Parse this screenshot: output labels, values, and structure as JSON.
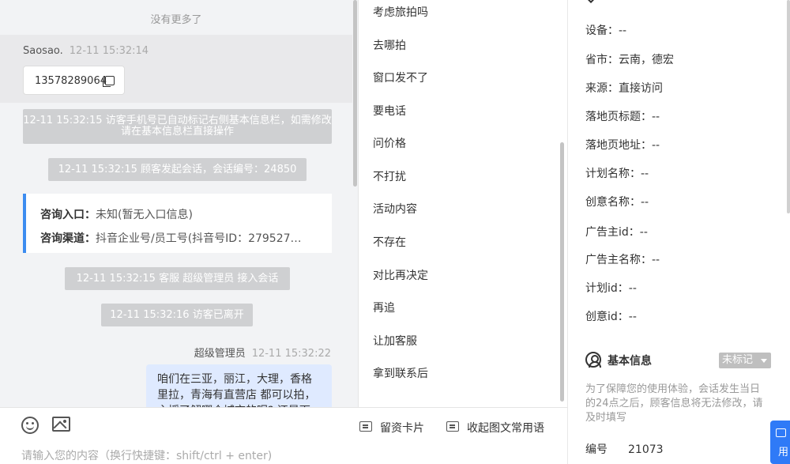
{
  "chat": {
    "no_more": "没有更多了",
    "visitor_name": "Saosao.",
    "visitor_time": "12-11 15:32:14",
    "visitor_phone": "13578289064",
    "sys_msgs": [
      "12-11 15:32:15 访客手机号已自动标记右侧基本信息栏，如需修改请在基本信息栏直接操作",
      "12-11 15:32:15 顾客发起会话，会话编号：24850",
      "12-11 15:32:15 客服 超级管理员 接入会话",
      "12-11 15:32:16 访客已离开"
    ],
    "entry_label": "咨询入口：",
    "entry_value": "未知(暂无入口信息)",
    "channel_label": "咨询渠道：",
    "channel_value": "抖音企业号/员工号(抖音号ID：279527…",
    "agent_name": "超级管理员",
    "agent_time": "12-11 15:32:22",
    "agent_message": "咱们在三亚，丽江，大理，香格里拉，青海有直营店 都可以拍，主授了解哪个城市的呢? 还是下"
  },
  "input": {
    "leave_card": "留资卡片",
    "collapse_phrases": "收起图文常用语",
    "placeholder": "请输入您的内容（换行快捷键：shift/ctrl + enter)"
  },
  "quick_replies": [
    "考虑旅拍吗",
    "去哪拍",
    "窗口发不了",
    "要电话",
    "问价格",
    "不打扰",
    "活动内容",
    "不存在",
    "对比再决定",
    "再追",
    "让加客服",
    "拿到联系后"
  ],
  "info": {
    "fields": [
      {
        "label": "设备：",
        "value": "--"
      },
      {
        "label": "省市：",
        "value": "云南，德宏"
      },
      {
        "label": "来源：",
        "value": "直接访问"
      },
      {
        "label": "落地页标题：",
        "value": "--"
      },
      {
        "label": "落地页地址：",
        "value": "--"
      },
      {
        "label": "计划名称：",
        "value": "--"
      },
      {
        "label": "创意名称：",
        "value": "--"
      },
      {
        "label": "广告主id：",
        "value": "--"
      },
      {
        "label": "广告主名称：",
        "value": "--"
      },
      {
        "label": "计划id：",
        "value": "--"
      },
      {
        "label": "创意id：",
        "value": "--"
      }
    ],
    "basic_title": "基本信息",
    "tag": "未标记",
    "notice": "为了保障您的使用体验，会话发生当日的24点之后，顾客信息将无法修改，请及时填写",
    "id_label": "编号",
    "id_value": "21073"
  },
  "float_help": {
    "label": "用"
  },
  "colors": {
    "accent": "#3c8cf0",
    "agent_bubble": "#dfeaff",
    "system": "#cfd0d2",
    "float": "#2f7af7"
  }
}
